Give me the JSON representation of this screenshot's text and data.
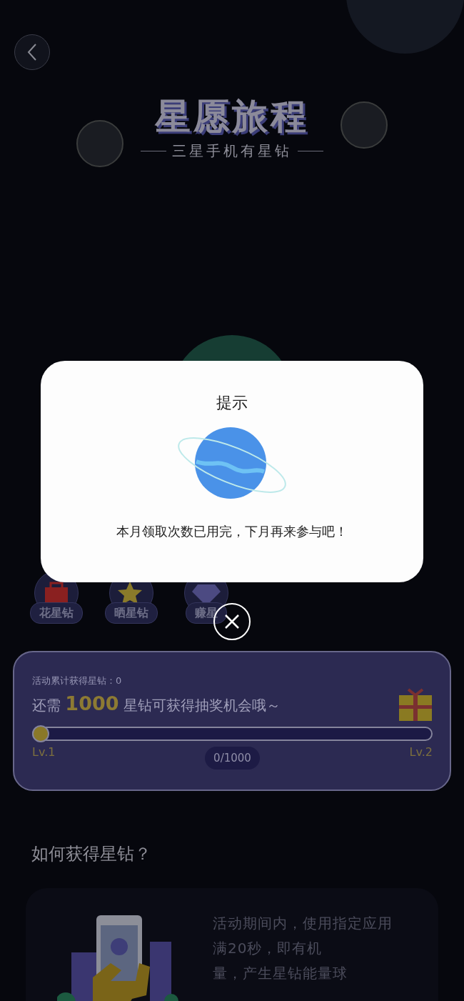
{
  "banner": {
    "title": "星愿旅程",
    "subtitle": "三星手机有星钻"
  },
  "badges": [
    {
      "kind": "bag",
      "label": "花星钻"
    },
    {
      "kind": "star",
      "label": "晒星钻"
    },
    {
      "kind": "diamond",
      "label": "赚星"
    }
  ],
  "progress_card": {
    "total_label": "活动累计获得星钻：0",
    "need_text": "还需 **1000** 星钻可获得抽奖机会哦～",
    "level": 0,
    "start_label": "Lv.1",
    "end_label": "Lv.2",
    "count": "0/1000"
  },
  "how_to": {
    "heading": "如何获得星钻？",
    "lines": [
      "活动期间内，使用指定应用",
      "满20秒，即有机",
      "量，产生星钻能量球"
    ]
  },
  "dialog": {
    "title": "提示",
    "message": "本月领取次数已用完，下月再来参与吧！"
  }
}
